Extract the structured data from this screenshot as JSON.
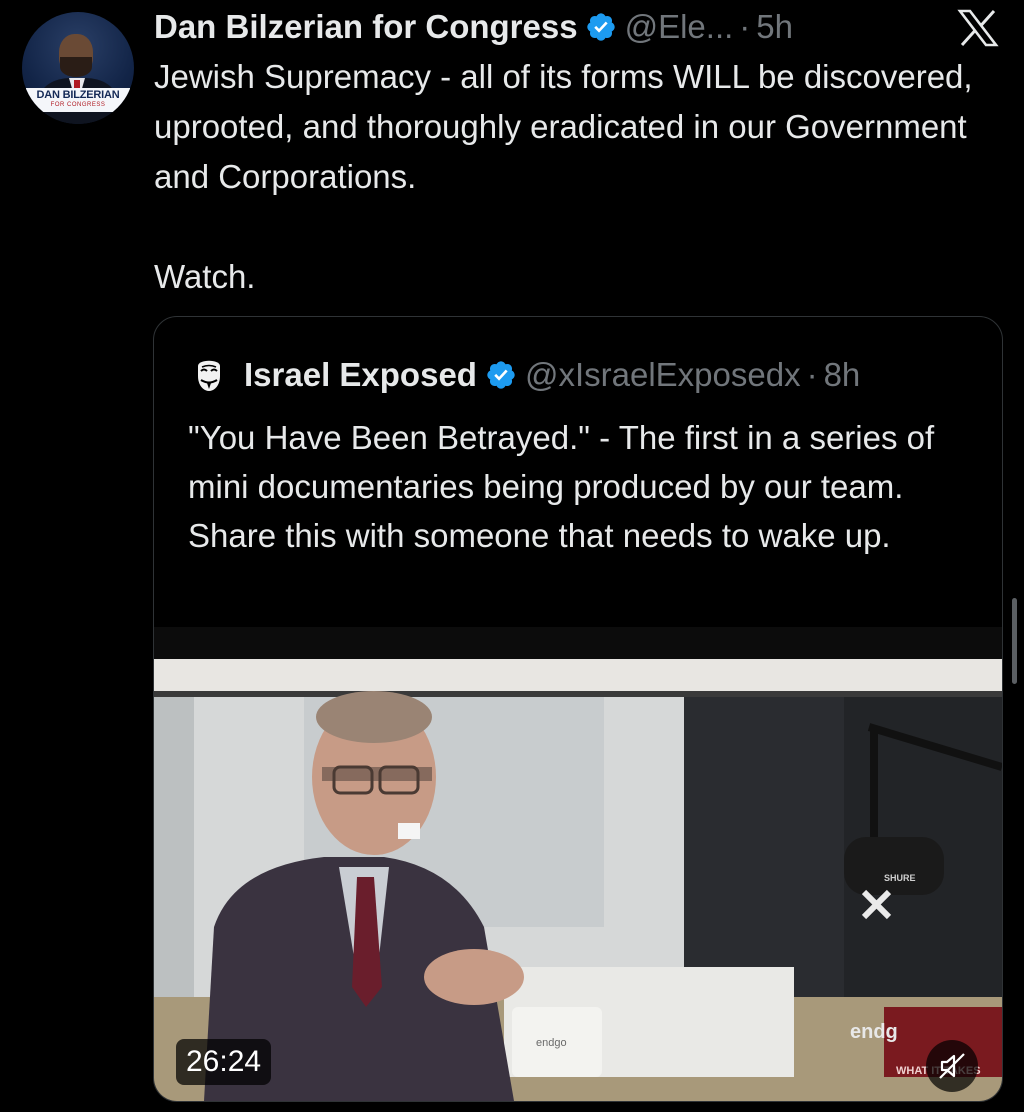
{
  "tweet": {
    "author_name": "Dan Bilzerian for Congress",
    "handle": "@Ele...",
    "separator": "·",
    "time": "5h",
    "verified": true,
    "text_line_1": "Jewish Supremacy - all of its forms WILL be discovered, uprooted, and thoroughly eradicated in our Government and Corporations.",
    "text_line_2": "Watch.",
    "avatar": {
      "banner_name": "DAN BILZERIAN",
      "banner_sub": "FOR CONGRESS"
    }
  },
  "quoted_tweet": {
    "author_name": "Israel Exposed",
    "handle": "@xIsraelExposedx",
    "separator": "·",
    "time": "8h",
    "verified": true,
    "avatar_icon": "guy-fawkes-mask-icon",
    "text": "\"You Have Been Betrayed.\" - The first in a series of mini documentaries being  produced by our team. Share this with someone that needs to wake up.",
    "video": {
      "duration": "26:24",
      "muted": true,
      "mic_brand": "SHURE",
      "cup_brand": "endgo",
      "sign_brand": "endg",
      "sign_tagline": "WHAT IT TAKES"
    }
  },
  "app": {
    "logo_icon": "x-logo-icon"
  },
  "colors": {
    "background": "#000000",
    "text_primary": "#e7e9ea",
    "text_secondary": "#71767b",
    "verified_blue": "#1d9bf0",
    "border": "#2f3336"
  }
}
